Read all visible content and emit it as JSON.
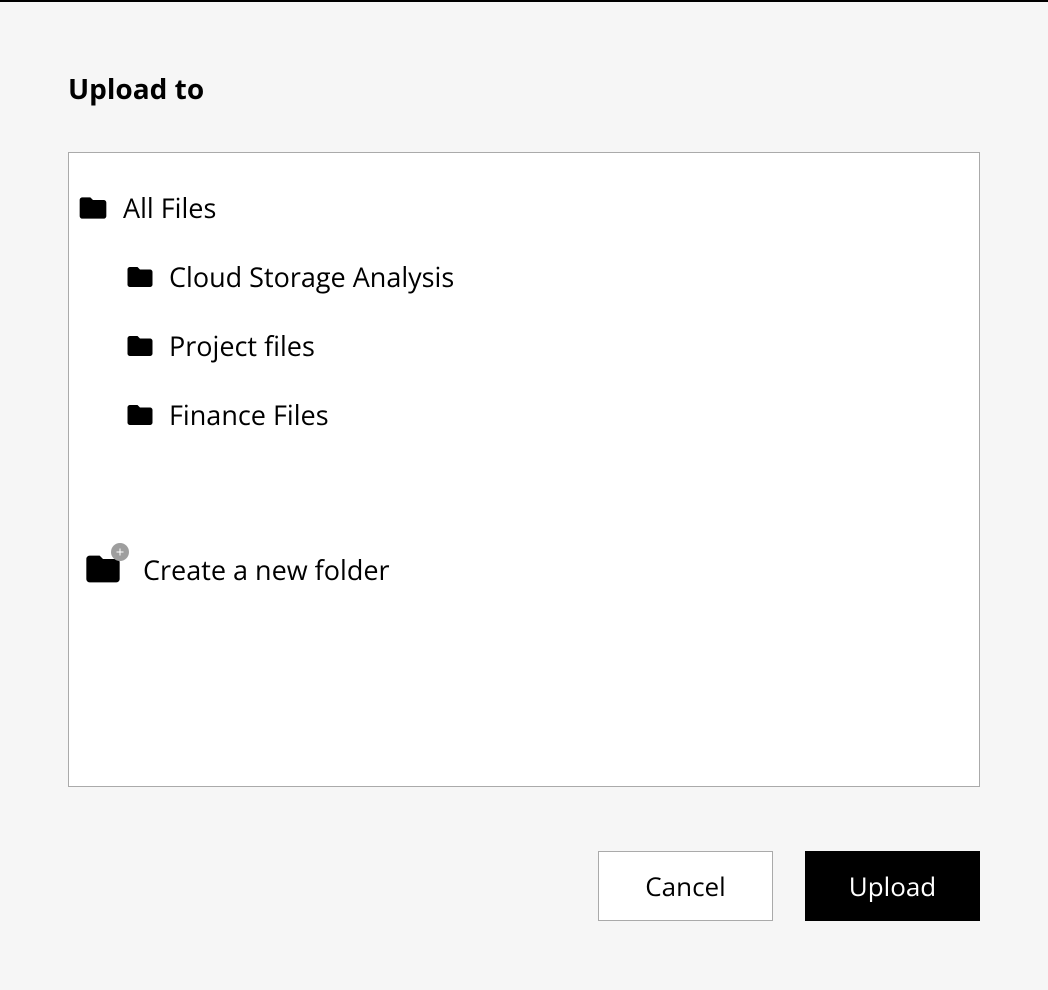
{
  "title": "Upload to",
  "tree": {
    "root": {
      "label": "All Files"
    },
    "children": [
      {
        "label": "Cloud Storage Analysis"
      },
      {
        "label": "Project files"
      },
      {
        "label": "Finance Files"
      }
    ]
  },
  "create_folder_label": "Create a new folder",
  "buttons": {
    "cancel": "Cancel",
    "upload": "Upload"
  }
}
